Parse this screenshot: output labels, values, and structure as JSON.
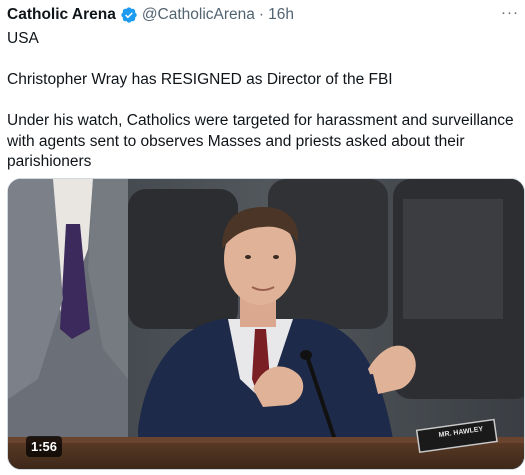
{
  "tweet": {
    "author_name": "Catholic Arena",
    "handle": "@CatholicArena",
    "separator": "·",
    "time": "16h",
    "more": "···",
    "text": {
      "line1": "USA",
      "line2": "Christopher Wray has RESIGNED as Director of the FBI",
      "line3": "Under his watch, Catholics were targeted for harassment and surveillance with agents sent to observes Masses and priests asked about their parishioners"
    },
    "media": {
      "duration": "1:56",
      "nameplate": "MR. HAWLEY"
    }
  },
  "colors": {
    "verified_badge": "#1d9bf0",
    "secondary_text": "#536471",
    "border": "#cfd9de"
  },
  "icons": {
    "verified": "verified-badge-icon",
    "more": "more-options-icon"
  }
}
